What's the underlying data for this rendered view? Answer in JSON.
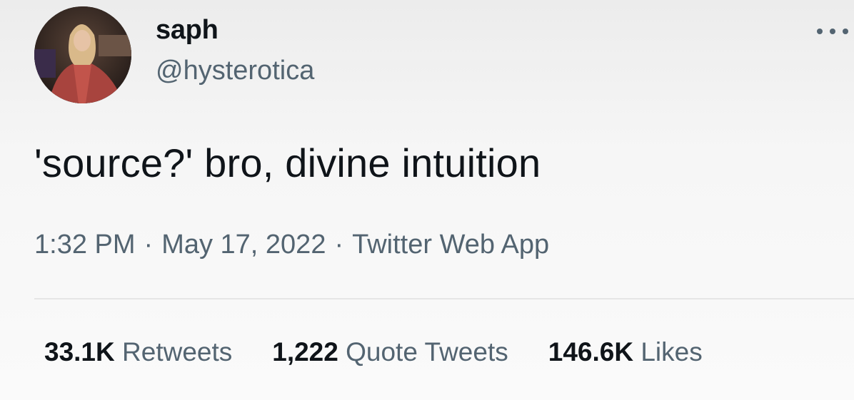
{
  "user": {
    "display_name": "saph",
    "handle": "@hysterotica"
  },
  "tweet": {
    "text": "'source?' bro, divine intuition"
  },
  "meta": {
    "time": "1:32 PM",
    "date": "May 17, 2022",
    "client": "Twitter Web App",
    "separator": "·"
  },
  "stats": {
    "retweets": {
      "count": "33.1K",
      "label": "Retweets"
    },
    "quotes": {
      "count": "1,222",
      "label": "Quote Tweets"
    },
    "likes": {
      "count": "146.6K",
      "label": "Likes"
    }
  },
  "icons": {
    "more": "more-horizontal-icon"
  },
  "colors": {
    "primary_text": "#0f1419",
    "secondary_text": "#536471",
    "divider": "#e6e6e6"
  }
}
